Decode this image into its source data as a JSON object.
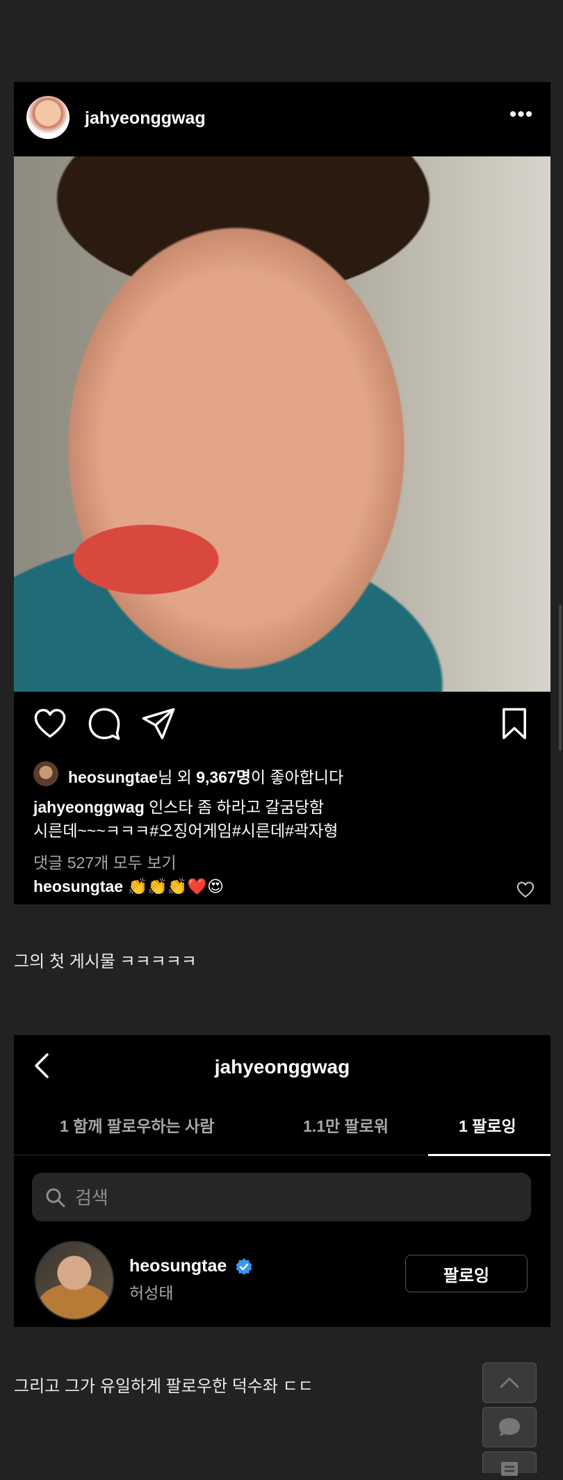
{
  "post": {
    "username": "jahyeonggwag",
    "more_label": "•••",
    "likes": {
      "user": "heosungtae",
      "text_mid": "님 외 ",
      "count": "9,367명",
      "text_end": "이 좋아합니다"
    },
    "caption": {
      "user": "jahyeonggwag",
      "line1": " 인스타 좀 하라고 갈굼당함",
      "line2": "시른데~~~ㅋㅋㅋ#오징어게임#시른데#곽자형"
    },
    "view_comments": "댓글 527개 모두 보기",
    "comment": {
      "user": "heosungtae",
      "text": " 👏👏👏❤️😍"
    }
  },
  "text1": "그의 첫 게시물 ㅋㅋㅋㅋㅋ",
  "following_page": {
    "title": "jahyeonggwag",
    "tabs": [
      {
        "label": "1 함께 팔로우하는 사람"
      },
      {
        "label": "1.1만 팔로워"
      },
      {
        "label": "1 팔로잉"
      }
    ],
    "search_placeholder": "검색",
    "user": {
      "username": "heosungtae",
      "real_name": "허성태",
      "button_label": "팔로잉"
    }
  },
  "text2": "그리고 그가 유일하게 팔로우한 덕수좌 ㄷㄷ",
  "colors": {
    "background": "#222223",
    "card": "#000000",
    "muted_text": "#a8a8a8",
    "verified": "#3897f0"
  }
}
